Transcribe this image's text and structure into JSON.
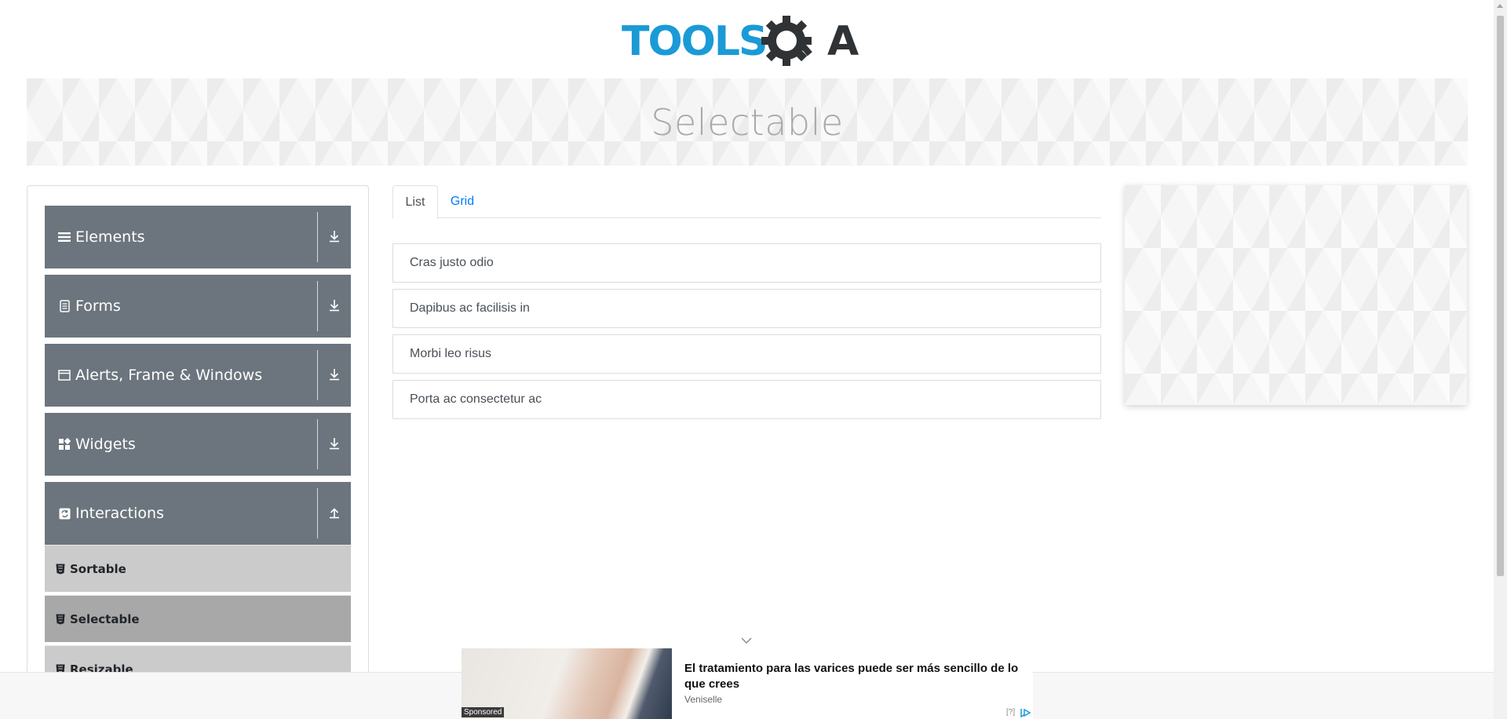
{
  "header": {
    "logo_text": "TOOLSQA"
  },
  "banner": {
    "title": "Selectable"
  },
  "sidebar": {
    "groups": [
      {
        "label": "Elements",
        "icon": "menu-icon",
        "state": "collapsed"
      },
      {
        "label": "Forms",
        "icon": "form-icon",
        "state": "collapsed"
      },
      {
        "label": "Alerts, Frame & Windows",
        "icon": "window-icon",
        "state": "collapsed"
      },
      {
        "label": "Widgets",
        "icon": "widgets-icon",
        "state": "collapsed"
      },
      {
        "label": "Interactions",
        "icon": "interactions-icon",
        "state": "expanded"
      }
    ],
    "interactions_items": [
      {
        "label": "Sortable",
        "active": false
      },
      {
        "label": "Selectable",
        "active": true
      },
      {
        "label": "Resizable",
        "active": false
      }
    ]
  },
  "tabs": [
    {
      "label": "List",
      "active": true
    },
    {
      "label": "Grid",
      "active": false
    }
  ],
  "list_items": [
    "Cras justo odio",
    "Dapibus ac facilisis in",
    "Morbi leo risus",
    "Porta ac consectetur ac"
  ],
  "ad": {
    "headline": "El tratamiento para las varices puede ser más sencillo de lo que crees",
    "source": "Veniselle",
    "sponsored": "Sponsored",
    "info": "[?]"
  },
  "colors": {
    "brand_blue": "#1a9ad6",
    "brand_dark": "#2f3335",
    "group_bg": "#6c757d",
    "sub_bg": "#cbcbcb",
    "sub_active_bg": "#a8a8a8",
    "link": "#007bff"
  }
}
